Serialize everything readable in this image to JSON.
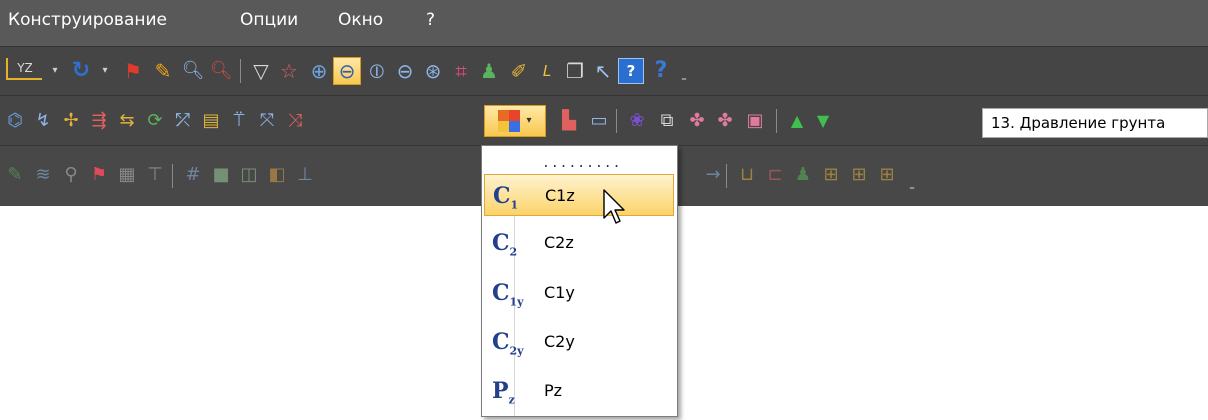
{
  "menu": [
    {
      "label": "Конструирование"
    },
    {
      "label": "Опции"
    },
    {
      "label": "Окно"
    },
    {
      "label": "?"
    }
  ],
  "toolbar1": {
    "axis_label": "YZ",
    "icons": [
      "axis-yz-icon",
      "undo-rotate-icon",
      "flag-icon",
      "pencil-icon",
      "zoom-icon",
      "zoom-select-icon",
      "filter-icon",
      "polygon-select-icon",
      "zoom-in-icon",
      "zoom-out-icon",
      "section-icon",
      "minus-icon",
      "target-icon",
      "grid-icon",
      "paint-icon",
      "highlighter-icon",
      "length-icon",
      "copy-icon",
      "help-cursor-icon",
      "help-book-icon",
      "help-icon"
    ]
  },
  "toolbar2": {
    "load_case": "13. Дравление грунта"
  },
  "dropdown": {
    "dots": ".........",
    "items": [
      {
        "symbol": "C",
        "sub": "1",
        "label": "C1z",
        "selected": true
      },
      {
        "symbol": "C",
        "sub": "2",
        "label": "C2z",
        "selected": false
      },
      {
        "symbol": "C",
        "sub": "1y",
        "label": "C1y",
        "selected": false
      },
      {
        "symbol": "C",
        "sub": "2y",
        "label": "C2y",
        "selected": false
      },
      {
        "symbol": "P",
        "sub": "z",
        "label": "Pz",
        "selected": false
      }
    ]
  },
  "colors": {
    "menubar": "#595959",
    "toolbar": "#454545",
    "highlight": "#f9c74f",
    "icon_blue": "#23408e"
  }
}
